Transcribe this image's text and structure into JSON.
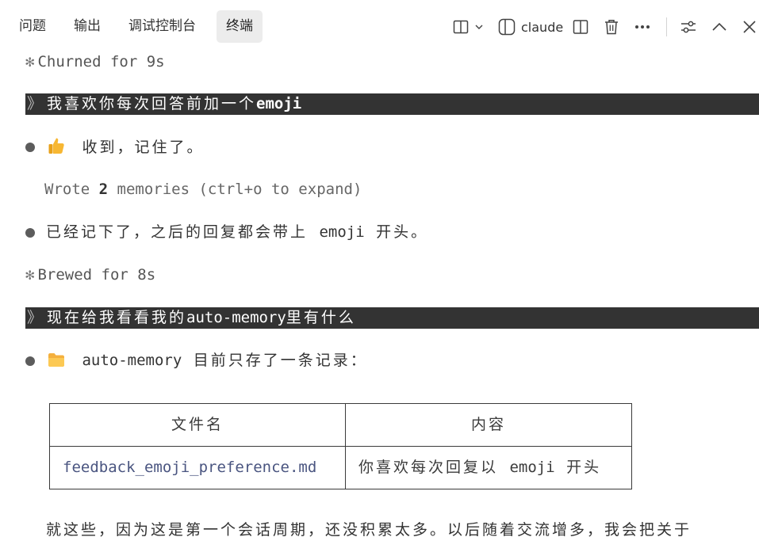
{
  "header": {
    "tabs": [
      {
        "label": "问题"
      },
      {
        "label": "输出"
      },
      {
        "label": "调试控制台"
      },
      {
        "label": "终端",
        "active": true
      }
    ],
    "terminal_name": "claude",
    "icons": [
      "split-layout-icon",
      "chevron-down-icon",
      "terminal-panel-icon",
      "split-editor-icon",
      "trash-icon",
      "more-icon",
      "settings-sliders-icon",
      "chevron-up-icon",
      "close-icon"
    ]
  },
  "terminal": {
    "status1": {
      "glyph": "✻",
      "text": "Churned for 9s"
    },
    "prompt1": {
      "chevron": "》",
      "text": "我喜欢你每次回答前加一个",
      "keyword": "emoji"
    },
    "reply1": "收到，记住了。",
    "memory_note": {
      "prefix": "Wrote ",
      "count": "2",
      "suffix": " memories (ctrl+o to expand)"
    },
    "reply2": {
      "pre": "已经记下了，之后的回复都会带上 ",
      "keyword": "emoji",
      "post": " 开头。"
    },
    "status2": {
      "glyph": "✻",
      "text": "Brewed for 8s"
    },
    "prompt2": {
      "chevron": "》",
      "pre": "现在给我看看我的",
      "keyword": "auto-memory",
      "post": "里有什么"
    },
    "reply3": {
      "keyword": "auto-memory",
      "text": " 目前只存了一条记录："
    },
    "table": {
      "headers": [
        "文件名",
        "内容"
      ],
      "rows": [
        {
          "file": "feedback_emoji_preference.md",
          "desc_pre": "你喜欢每次回复以 ",
          "desc_keyword": "emoji",
          "desc_post": " 开头"
        }
      ]
    },
    "trailing": "就这些，因为这是第一个会话周期，还没积累太多。以后随着交流增多，我会把关于"
  },
  "colors": {
    "prompt_bg": "#333333",
    "active_tab_bg": "#ececec",
    "file_link": "#4a5580"
  }
}
